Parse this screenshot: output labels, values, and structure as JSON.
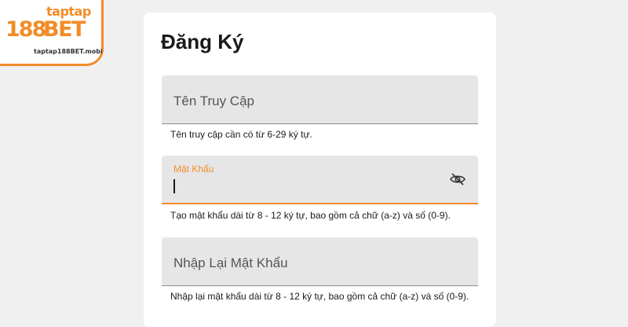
{
  "logo": {
    "brand_top": "taptap",
    "brand_num": "188",
    "brand_bet": "BET",
    "url": "taptap188BET.mobi",
    "accent_color": "#f28c28"
  },
  "form": {
    "title": "Đăng Ký",
    "username": {
      "placeholder": "Tên Truy Cập",
      "helper": "Tên truy cập cần có từ 6-29 ký tự."
    },
    "password": {
      "label": "Mật Khẩu",
      "value": "",
      "toggle_icon": "eye-slash-icon",
      "helper": "Tạo mật khẩu dài từ 8 - 12 ký tự, bao gồm cả chữ (a-z) và số (0-9)."
    },
    "confirm_password": {
      "placeholder": "Nhập Lại Mật Khẩu",
      "helper": "Nhập lại mật khẩu dài từ 8 - 12 ký tự, bao gồm cả chữ (a-z) và số (0-9)."
    }
  }
}
